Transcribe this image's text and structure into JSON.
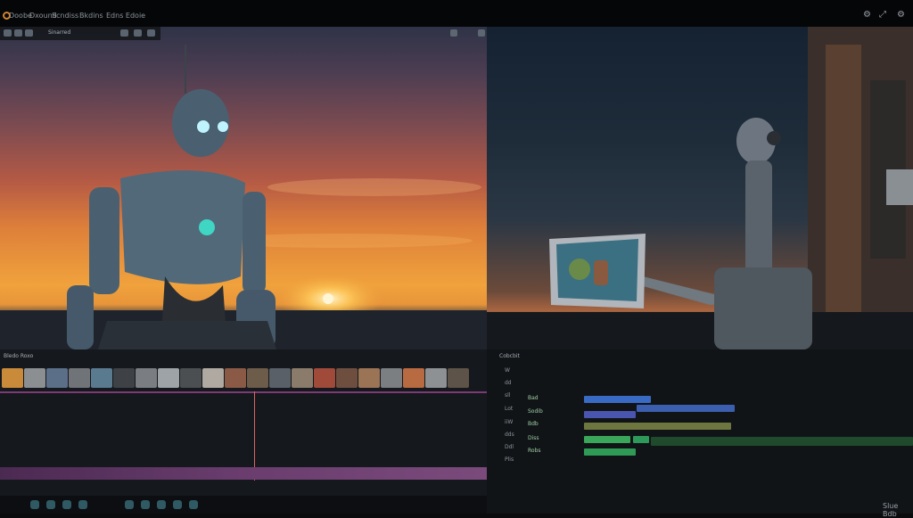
{
  "menu": {
    "items": [
      "Doobe",
      "Dxound",
      "Scndiss",
      "Bkdins",
      "Edns Edoie"
    ]
  },
  "left_viewer": {
    "toolbar_label": "Sinarred"
  },
  "left_panel": {
    "header_title": "Bledo Roxo"
  },
  "right_panel": {
    "header_title": "Cobcbit",
    "side_labels": [
      "W",
      "dd",
      "sll",
      "Lot",
      "iiW",
      "dds",
      "Ddl",
      "Plis"
    ],
    "track_labels": [
      "Bad",
      "Sodib",
      "Bdb",
      "Diss",
      "Robs"
    ]
  },
  "footer": {
    "right_text": "Slue Bdb"
  },
  "colors": {
    "accent": "#d0852c",
    "clip_blue": "#3a6bc4",
    "clip_green": "#3aa659",
    "track_purple": "#6a3d6e",
    "playhead": "#d9665f"
  },
  "icons": {
    "window": [
      "gear-icon",
      "expand-icon",
      "settings-icon"
    ]
  }
}
